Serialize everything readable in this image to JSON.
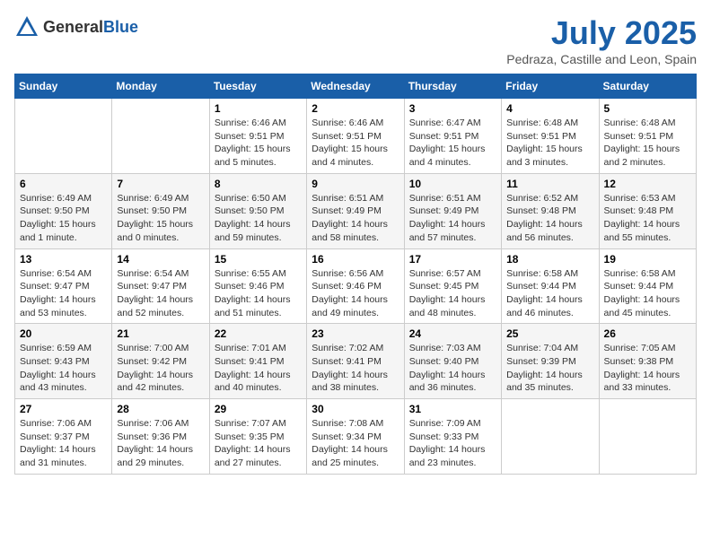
{
  "header": {
    "logo_general": "General",
    "logo_blue": "Blue",
    "month_title": "July 2025",
    "location": "Pedraza, Castille and Leon, Spain"
  },
  "weekdays": [
    "Sunday",
    "Monday",
    "Tuesday",
    "Wednesday",
    "Thursday",
    "Friday",
    "Saturday"
  ],
  "weeks": [
    [
      {
        "day": "",
        "info": ""
      },
      {
        "day": "",
        "info": ""
      },
      {
        "day": "1",
        "info": "Sunrise: 6:46 AM\nSunset: 9:51 PM\nDaylight: 15 hours\nand 5 minutes."
      },
      {
        "day": "2",
        "info": "Sunrise: 6:46 AM\nSunset: 9:51 PM\nDaylight: 15 hours\nand 4 minutes."
      },
      {
        "day": "3",
        "info": "Sunrise: 6:47 AM\nSunset: 9:51 PM\nDaylight: 15 hours\nand 4 minutes."
      },
      {
        "day": "4",
        "info": "Sunrise: 6:48 AM\nSunset: 9:51 PM\nDaylight: 15 hours\nand 3 minutes."
      },
      {
        "day": "5",
        "info": "Sunrise: 6:48 AM\nSunset: 9:51 PM\nDaylight: 15 hours\nand 2 minutes."
      }
    ],
    [
      {
        "day": "6",
        "info": "Sunrise: 6:49 AM\nSunset: 9:50 PM\nDaylight: 15 hours\nand 1 minute."
      },
      {
        "day": "7",
        "info": "Sunrise: 6:49 AM\nSunset: 9:50 PM\nDaylight: 15 hours\nand 0 minutes."
      },
      {
        "day": "8",
        "info": "Sunrise: 6:50 AM\nSunset: 9:50 PM\nDaylight: 14 hours\nand 59 minutes."
      },
      {
        "day": "9",
        "info": "Sunrise: 6:51 AM\nSunset: 9:49 PM\nDaylight: 14 hours\nand 58 minutes."
      },
      {
        "day": "10",
        "info": "Sunrise: 6:51 AM\nSunset: 9:49 PM\nDaylight: 14 hours\nand 57 minutes."
      },
      {
        "day": "11",
        "info": "Sunrise: 6:52 AM\nSunset: 9:48 PM\nDaylight: 14 hours\nand 56 minutes."
      },
      {
        "day": "12",
        "info": "Sunrise: 6:53 AM\nSunset: 9:48 PM\nDaylight: 14 hours\nand 55 minutes."
      }
    ],
    [
      {
        "day": "13",
        "info": "Sunrise: 6:54 AM\nSunset: 9:47 PM\nDaylight: 14 hours\nand 53 minutes."
      },
      {
        "day": "14",
        "info": "Sunrise: 6:54 AM\nSunset: 9:47 PM\nDaylight: 14 hours\nand 52 minutes."
      },
      {
        "day": "15",
        "info": "Sunrise: 6:55 AM\nSunset: 9:46 PM\nDaylight: 14 hours\nand 51 minutes."
      },
      {
        "day": "16",
        "info": "Sunrise: 6:56 AM\nSunset: 9:46 PM\nDaylight: 14 hours\nand 49 minutes."
      },
      {
        "day": "17",
        "info": "Sunrise: 6:57 AM\nSunset: 9:45 PM\nDaylight: 14 hours\nand 48 minutes."
      },
      {
        "day": "18",
        "info": "Sunrise: 6:58 AM\nSunset: 9:44 PM\nDaylight: 14 hours\nand 46 minutes."
      },
      {
        "day": "19",
        "info": "Sunrise: 6:58 AM\nSunset: 9:44 PM\nDaylight: 14 hours\nand 45 minutes."
      }
    ],
    [
      {
        "day": "20",
        "info": "Sunrise: 6:59 AM\nSunset: 9:43 PM\nDaylight: 14 hours\nand 43 minutes."
      },
      {
        "day": "21",
        "info": "Sunrise: 7:00 AM\nSunset: 9:42 PM\nDaylight: 14 hours\nand 42 minutes."
      },
      {
        "day": "22",
        "info": "Sunrise: 7:01 AM\nSunset: 9:41 PM\nDaylight: 14 hours\nand 40 minutes."
      },
      {
        "day": "23",
        "info": "Sunrise: 7:02 AM\nSunset: 9:41 PM\nDaylight: 14 hours\nand 38 minutes."
      },
      {
        "day": "24",
        "info": "Sunrise: 7:03 AM\nSunset: 9:40 PM\nDaylight: 14 hours\nand 36 minutes."
      },
      {
        "day": "25",
        "info": "Sunrise: 7:04 AM\nSunset: 9:39 PM\nDaylight: 14 hours\nand 35 minutes."
      },
      {
        "day": "26",
        "info": "Sunrise: 7:05 AM\nSunset: 9:38 PM\nDaylight: 14 hours\nand 33 minutes."
      }
    ],
    [
      {
        "day": "27",
        "info": "Sunrise: 7:06 AM\nSunset: 9:37 PM\nDaylight: 14 hours\nand 31 minutes."
      },
      {
        "day": "28",
        "info": "Sunrise: 7:06 AM\nSunset: 9:36 PM\nDaylight: 14 hours\nand 29 minutes."
      },
      {
        "day": "29",
        "info": "Sunrise: 7:07 AM\nSunset: 9:35 PM\nDaylight: 14 hours\nand 27 minutes."
      },
      {
        "day": "30",
        "info": "Sunrise: 7:08 AM\nSunset: 9:34 PM\nDaylight: 14 hours\nand 25 minutes."
      },
      {
        "day": "31",
        "info": "Sunrise: 7:09 AM\nSunset: 9:33 PM\nDaylight: 14 hours\nand 23 minutes."
      },
      {
        "day": "",
        "info": ""
      },
      {
        "day": "",
        "info": ""
      }
    ]
  ]
}
